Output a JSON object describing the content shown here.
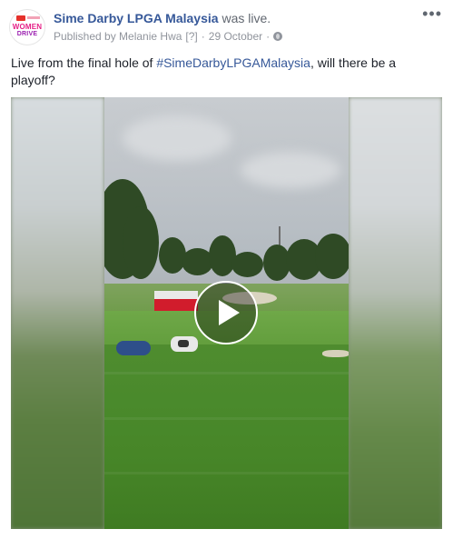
{
  "post": {
    "page_name": "Sime Darby LPGA Malaysia",
    "status_suffix": "was live.",
    "published_by": "Published by Melanie Hwa",
    "help_marker": "[?]",
    "date": "29 October",
    "more_label": "•••",
    "message_before": "Live from the final hole of ",
    "hashtag": "#SimeDarbyLPGAMalaysia",
    "message_after": ", will there be a playoff?",
    "avatar": {
      "line1": "WOMEN",
      "line2": "DRIVE"
    },
    "icons": {
      "privacy": "globe-icon",
      "play": "play-icon",
      "more": "more-options-icon"
    }
  }
}
